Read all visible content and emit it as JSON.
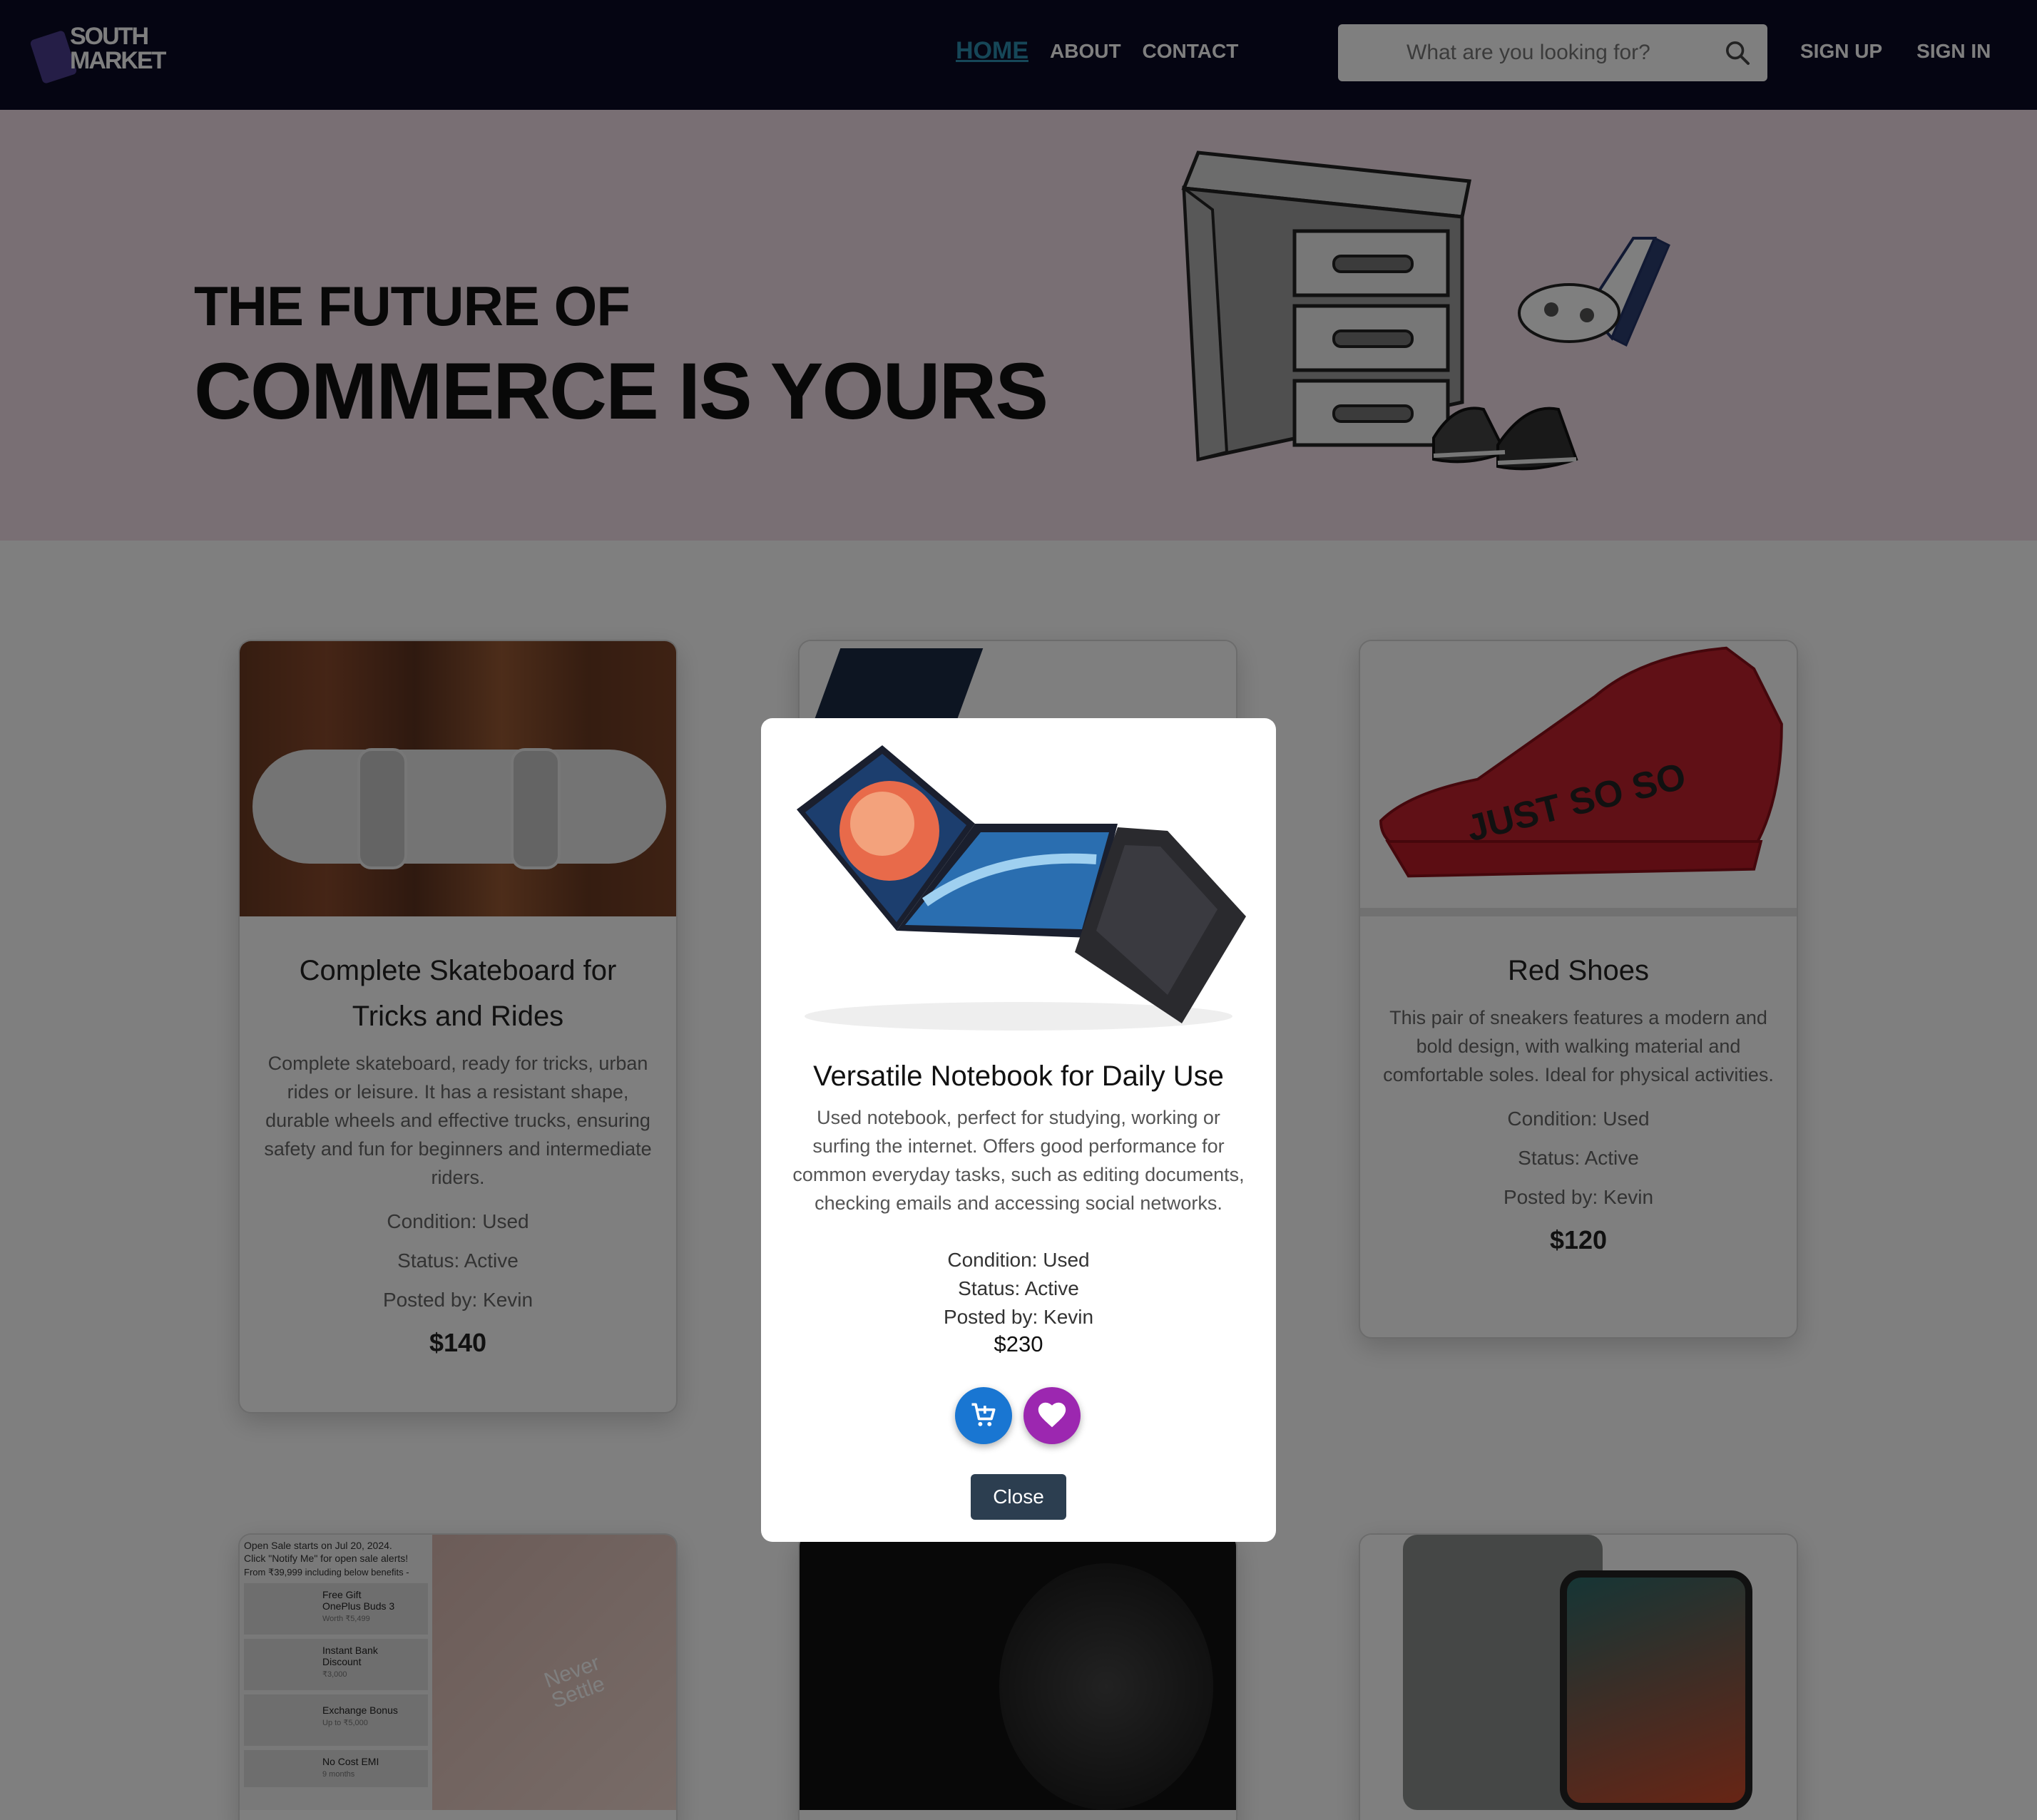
{
  "header": {
    "logo_line1": "SOUTH",
    "logo_line2": "MARKET",
    "nav": {
      "home": "HOME",
      "about": "ABOUT",
      "contact": "CONTACT"
    },
    "search_placeholder": "What are you looking for?",
    "sign_up": "SIGN UP",
    "sign_in": "SIGN IN"
  },
  "hero": {
    "line1": "THE FUTURE OF",
    "line2": "COMMERCE IS YOURS"
  },
  "products": [
    {
      "title": "Complete Skateboard for Tricks and Rides",
      "description": "Complete skateboard, ready for tricks, urban rides or leisure. It has a resistant shape, durable wheels and effective trucks, ensuring safety and fun for beginners and intermediate riders.",
      "condition": "Condition: Used",
      "status": "Status: Active",
      "posted_by": "Posted by: Kevin",
      "price": "$140"
    },
    {
      "title": "Red Shoes",
      "description": "This pair of sneakers features a modern and bold design, with walking material and comfortable soles. Ideal for physical activities.",
      "condition": "Condition: Used",
      "status": "Status: Active",
      "posted_by": "Posted by: Kevin",
      "price": "$120"
    }
  ],
  "promo_card": {
    "lines": [
      "Open Sale starts on Jul 20, 2024.",
      "Click \"Notify Me\" for open sale alerts!",
      "From ₹39,999 including below benefits -"
    ],
    "items": [
      {
        "title": "Free Gift",
        "subtitle": "OnePlus Buds 3",
        "detail": "Worth ₹5,499"
      },
      {
        "title": "Instant Bank",
        "subtitle": "Discount",
        "detail": "₹3,000"
      },
      {
        "title": "Exchange Bonus",
        "subtitle": "",
        "detail": "Up to ₹5,000"
      },
      {
        "title": "No Cost EMI",
        "subtitle": "",
        "detail": "9 months"
      }
    ],
    "phone_text": "Never Settle"
  },
  "modal": {
    "title": "Versatile Notebook for Daily Use",
    "description": "Used notebook, perfect for studying, working or surfing the internet. Offers good performance for common everyday tasks, such as editing documents, checking emails and accessing social networks.",
    "condition": "Condition: Used",
    "status": "Status: Active",
    "posted_by": "Posted by: Kevin",
    "price": "$230",
    "close_label": "Close"
  },
  "colors": {
    "header_bg": "#0b0a24",
    "nav_active": "#2c8fb0",
    "hero_bg": "#f2dfe8",
    "cart_button": "#1976d2",
    "favorite_button": "#9c27b0",
    "close_button": "#2c3e50"
  },
  "icons": {
    "search": "search-icon",
    "cart": "cart-add-icon",
    "favorite": "heart-icon"
  }
}
